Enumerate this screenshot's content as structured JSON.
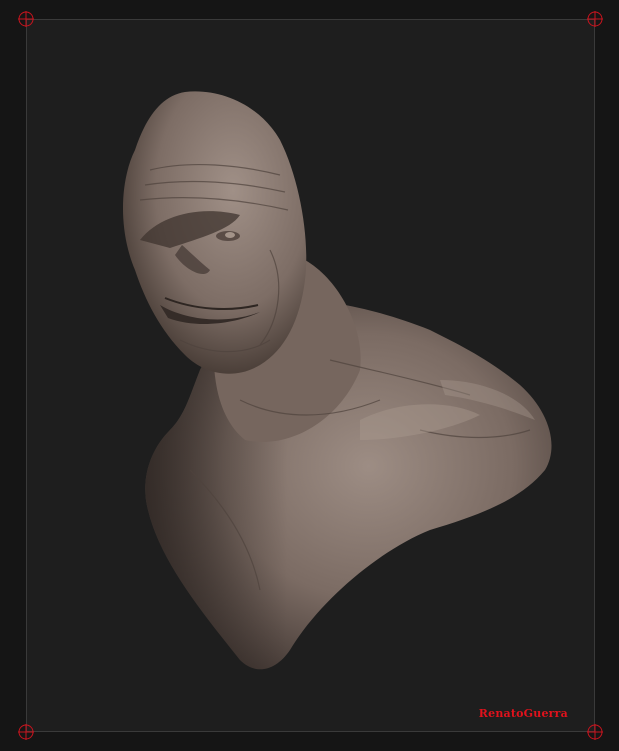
{
  "colors": {
    "background": "#151515",
    "canvas": "#1e1e1e",
    "frame_line": "#3a3a3a",
    "corner_marker": "#c8141e",
    "signature": "#e0121c",
    "clay_light": "#9a8a80",
    "clay_mid": "#7a6a62",
    "clay_dark": "#3e332f"
  },
  "viewport": {
    "subject_icon": "sculpted-bust-icon"
  },
  "signature": {
    "text": "RenatoGuerra"
  }
}
